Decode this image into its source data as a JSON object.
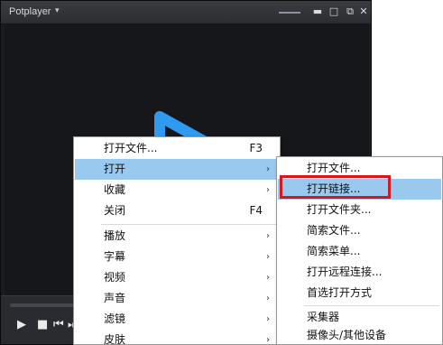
{
  "window": {
    "title": "Potplayer",
    "title_arrow": "▾",
    "min_glyph": "▬",
    "max_glyph": "□",
    "restore_glyph": "⧉",
    "close_glyph": "✕"
  },
  "controls": {
    "play": "▶",
    "stop": "■",
    "prev": "⏮",
    "next": "⏭"
  },
  "main_menu": {
    "items": [
      {
        "label": "打开文件...",
        "shortcut": "F3"
      },
      {
        "label": "打开",
        "arrow": "›"
      },
      {
        "label": "收藏",
        "arrow": "›"
      },
      {
        "label": "关闭",
        "shortcut": "F4"
      },
      {
        "label": "播放",
        "arrow": "›"
      },
      {
        "label": "字幕",
        "arrow": "›"
      },
      {
        "label": "视频",
        "arrow": "›"
      },
      {
        "label": "声音",
        "arrow": "›"
      },
      {
        "label": "滤镜",
        "arrow": "›"
      },
      {
        "label": "皮肤",
        "arrow": "›"
      }
    ]
  },
  "sub_menu": {
    "items": [
      {
        "label": "打开文件..."
      },
      {
        "label": "打开链接..."
      },
      {
        "label": "打开文件夹..."
      },
      {
        "label": "简索文件..."
      },
      {
        "label": "简索菜单..."
      },
      {
        "label": "打开远程连接..."
      },
      {
        "label": "首选打开方式"
      },
      {
        "label": "采集器"
      },
      {
        "label": "摄像头/其他设备"
      }
    ]
  },
  "colors": {
    "menu_highlight": "#99c9ef",
    "annotation_box": "#d7171f",
    "logo_blue": "#2f9bf0"
  }
}
